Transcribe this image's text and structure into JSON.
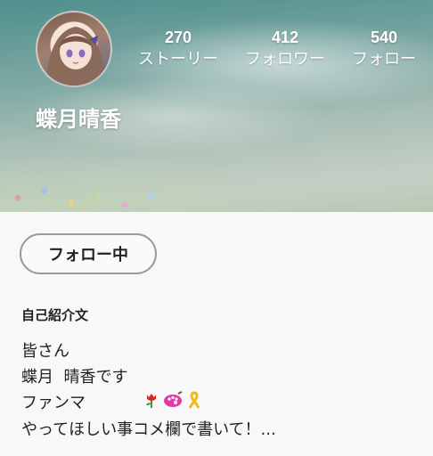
{
  "profile": {
    "username": "蝶月晴香",
    "avatar_icon": "avatar-image"
  },
  "stats": [
    {
      "value": "270",
      "label": "ストーリー"
    },
    {
      "value": "412",
      "label": "フォロワー"
    },
    {
      "value": "540",
      "label": "フォロー"
    }
  ],
  "follow_button": {
    "label": "フォロー中"
  },
  "bio": {
    "heading": "自己紹介文",
    "lines": [
      "皆さん",
      "蝶月  晴香です",
      "ファンマ",
      "やってほしい事コメ欄で書いて！..."
    ],
    "fan_mark_icons": [
      "tulip-icon",
      "palette-icon",
      "ribbon-icon"
    ]
  },
  "colors": {
    "header_teal": "#4e8f8d",
    "button_border": "#9a9a9a",
    "background": "#f8f8f8"
  }
}
